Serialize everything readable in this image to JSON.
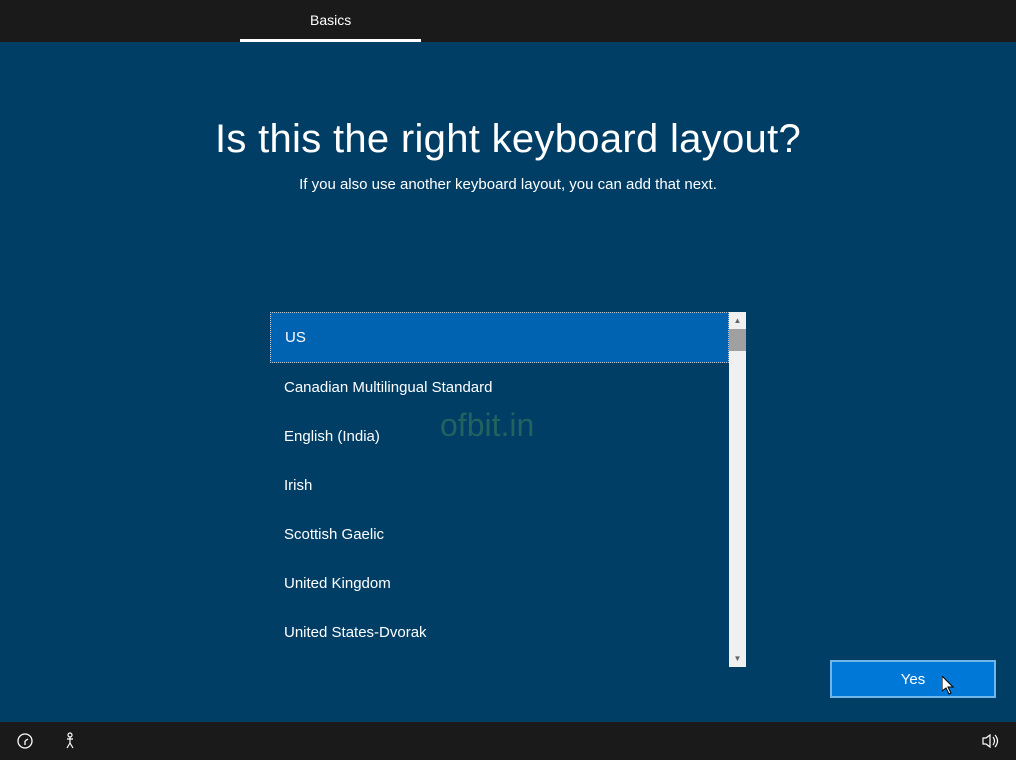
{
  "header": {
    "tab_label": "Basics"
  },
  "main": {
    "title": "Is this the right keyboard layout?",
    "subtitle": "If you also use another keyboard layout, you can add that next.",
    "layouts": [
      "US",
      "Canadian Multilingual Standard",
      "English (India)",
      "Irish",
      "Scottish Gaelic",
      "United Kingdom",
      "United States-Dvorak"
    ],
    "selected_index": 0,
    "yes_button": "Yes"
  },
  "watermark": "ofbit.in"
}
